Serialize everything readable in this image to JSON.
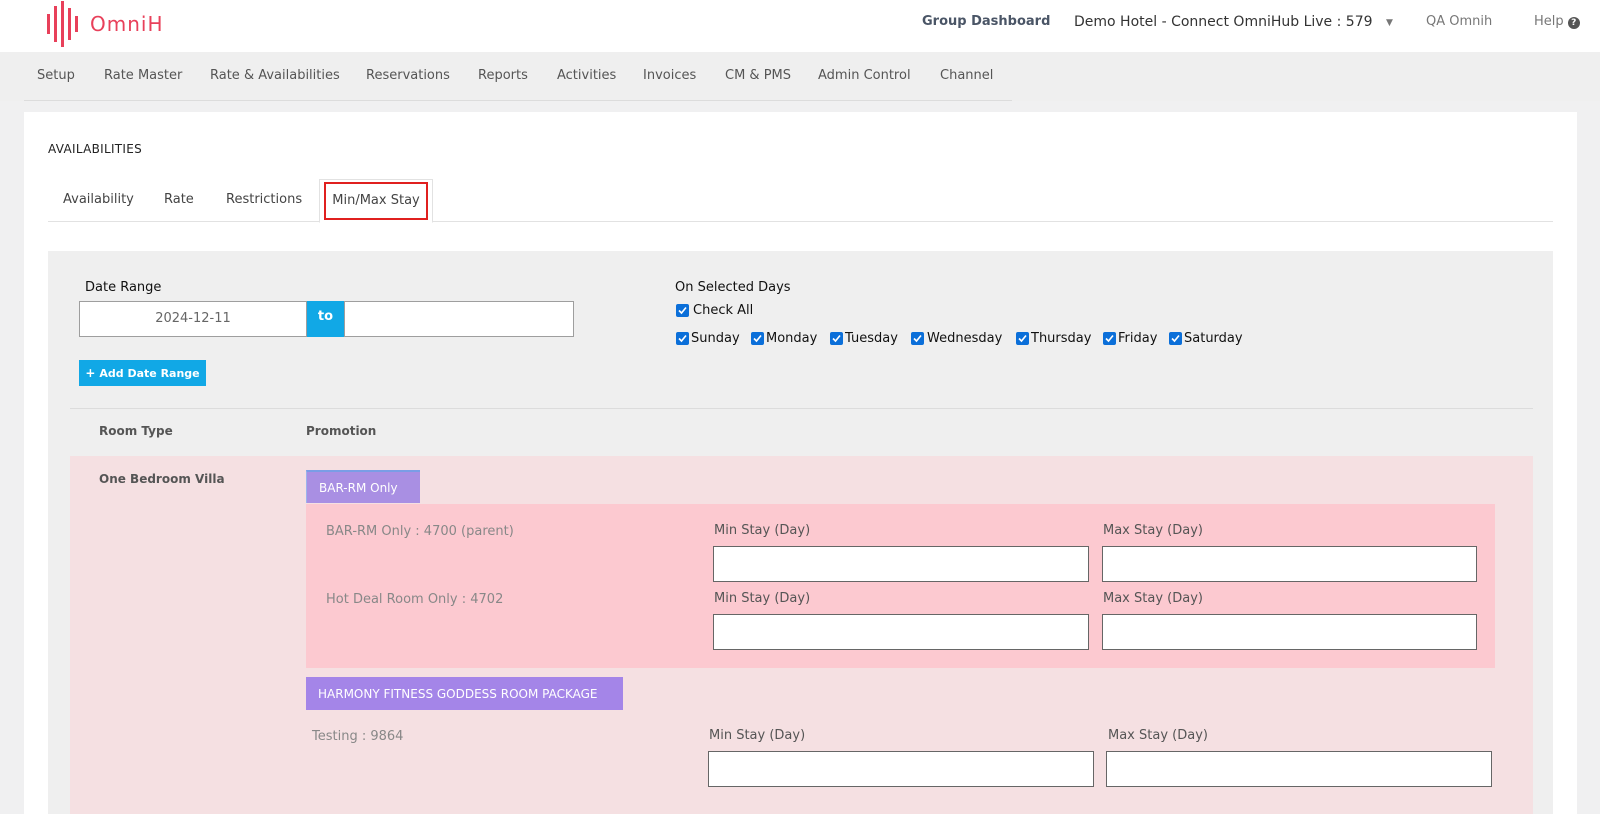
{
  "header": {
    "logo_text": "OmniH",
    "group_dashboard": "Group Dashboard",
    "hotel_selector": "Demo Hotel - Connect OmniHub Live : 579",
    "user": "QA Omnih",
    "help": "Help"
  },
  "nav": {
    "items": [
      "Setup",
      "Rate Master",
      "Rate & Availabilities",
      "Reservations",
      "Reports",
      "Activities",
      "Invoices",
      "CM & PMS",
      "Admin Control",
      "Channel"
    ]
  },
  "page": {
    "title": "AVAILABILITIES",
    "tabs": [
      "Availability",
      "Rate",
      "Restrictions",
      "Min/Max Stay"
    ],
    "active_tab": "Min/Max Stay"
  },
  "filters": {
    "date_range_label": "Date Range",
    "date_from": "2024-12-11",
    "to_label": "to",
    "date_to": "",
    "add_date_range": "Add Date Range",
    "selected_days_label": "On Selected Days",
    "check_all": "Check All",
    "days": [
      "Sunday",
      "Monday",
      "Tuesday",
      "Wednesday",
      "Thursday",
      "Friday",
      "Saturday"
    ]
  },
  "table": {
    "col_room_type": "Room Type",
    "col_promotion": "Promotion"
  },
  "rooms": [
    {
      "name": "One Bedroom Villa",
      "promotions": [
        {
          "name": "BAR-RM Only",
          "rates": [
            {
              "name": "BAR-RM Only : 4700 (parent)",
              "min_label": "Min Stay (Day)",
              "max_label": "Max Stay (Day)",
              "min_value": "",
              "max_value": ""
            },
            {
              "name": "Hot Deal Room Only : 4702",
              "min_label": "Min Stay (Day)",
              "max_label": "Max Stay (Day)",
              "min_value": "",
              "max_value": ""
            }
          ]
        },
        {
          "name": "HARMONY FITNESS GODDESS ROOM PACKAGE",
          "rates": [
            {
              "name": "Testing : 9864",
              "min_label": "Min Stay (Day)",
              "max_label": "Max Stay (Day)",
              "min_value": "",
              "max_value": ""
            }
          ]
        }
      ]
    }
  ],
  "colors": {
    "brand": "#e8405a",
    "accent": "#11a8e6",
    "promo": "#a98fe3",
    "checkbox": "#0b6fd9",
    "active_tab_border": "#e0201f"
  }
}
